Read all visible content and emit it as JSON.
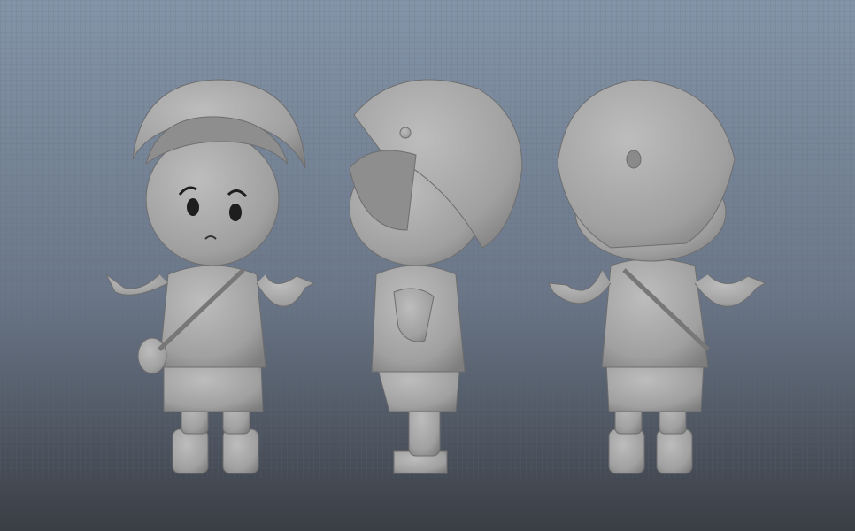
{
  "scene": {
    "views": [
      "front",
      "side",
      "back"
    ],
    "colors": {
      "bg_top": "#8494a8",
      "bg_mid": "#6b7789",
      "bg_bottom": "#3a3e45",
      "grid": "#5d6878",
      "model": "#a3a3a3",
      "model_shade": "#7e7e7e",
      "model_light": "#bdbdbd",
      "eyes": "#1e1e1e"
    }
  }
}
